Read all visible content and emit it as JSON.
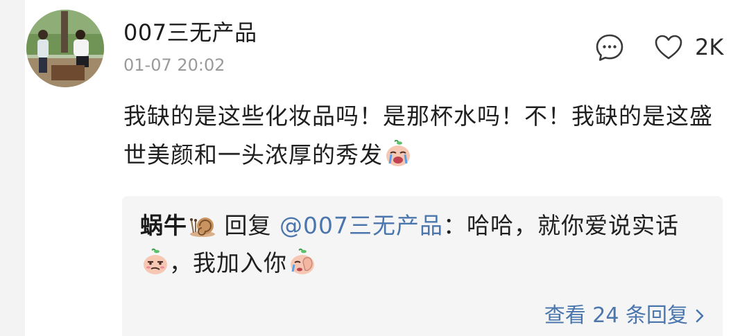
{
  "comment": {
    "username": "007三无产品",
    "timestamp": "01-07 20:02",
    "like_count": "2K",
    "text": "我缺的是这些化妆品吗！是那杯水吗！不！我缺的是这盛世美颜和一头浓厚的秀发"
  },
  "reply": {
    "author": "蜗牛",
    "verb": " 回复 ",
    "mention": "@007三无产品",
    "text_1": "：哈哈，就你爱说实话",
    "text_2": "，我加入你",
    "view_replies": "查看 24 条回复"
  },
  "icons": {
    "comment": "comment-bubble-icon",
    "like": "heart-outline-icon",
    "snail": "snail-emoji",
    "crying": "crying-emoji",
    "smirk": "smirk-emoji",
    "facepalm": "facepalm-emoji",
    "chevron": "chevron-right-icon"
  },
  "colors": {
    "link": "#4a76ad",
    "timestamp": "#9a9a9a",
    "reply_bg": "#f5f5f5"
  }
}
